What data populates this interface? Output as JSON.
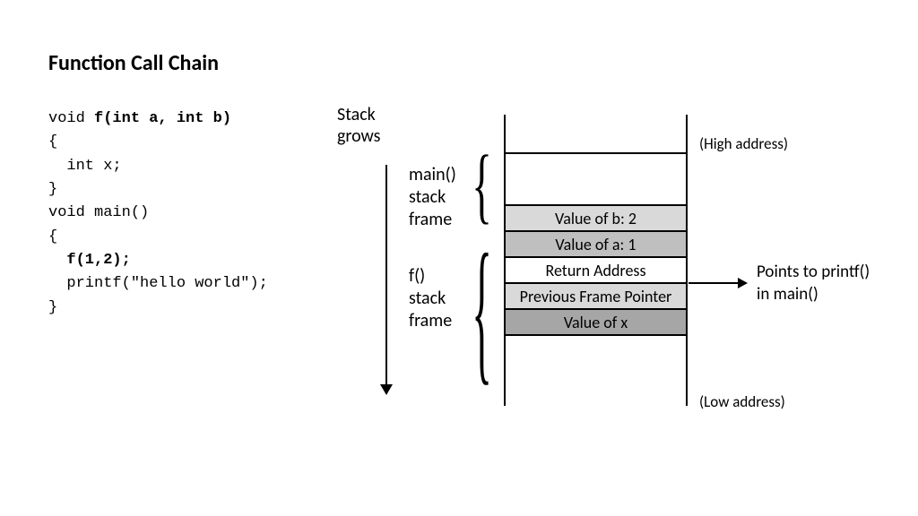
{
  "title": "Function Call Chain",
  "code": {
    "l1_pre": "void ",
    "l1_bold": "f(int a, int b)",
    "l2": "{",
    "l3": "  int x;",
    "l4": "}",
    "l5": "void main()",
    "l6": "{",
    "l7_pre": "  ",
    "l7_bold": "f(1,2);",
    "l8": "  printf(\"hello world\");",
    "l9": "}"
  },
  "stack_grows_l1": "Stack",
  "stack_grows_l2": "grows",
  "frame_main": "main()\nstack\nframe",
  "frame_f": "f()\nstack\nframe",
  "cells": {
    "b": "Value of b: 2",
    "a": "Value of a: 1",
    "ra": "Return Address",
    "pfp": "Previous Frame Pointer",
    "x": "Value of x"
  },
  "high_addr": "(High address)",
  "low_addr": "(Low address)",
  "ra_note_l1": "Points to printf()",
  "ra_note_l2": "in main()"
}
